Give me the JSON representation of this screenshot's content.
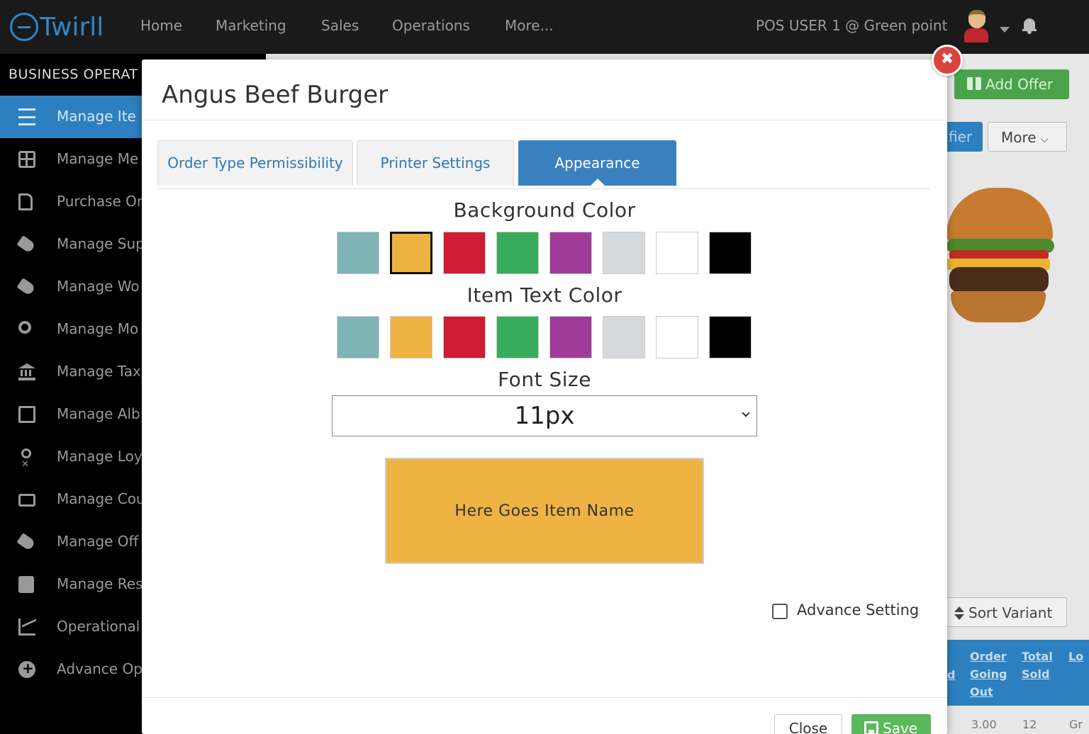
{
  "app": {
    "logo_text": "Twirll"
  },
  "nav": {
    "items": [
      "Home",
      "Marketing",
      "Sales",
      "Operations",
      "More..."
    ],
    "user": "POS USER 1 @ Green point"
  },
  "sidebar": {
    "heading": "BUSINESS OPERAT",
    "items": [
      {
        "label": "Manage Ite",
        "icon": "list-icon",
        "active": true
      },
      {
        "label": "Manage Me",
        "icon": "grid-icon"
      },
      {
        "label": "Purchase Or",
        "icon": "document-icon"
      },
      {
        "label": "Manage Sup",
        "icon": "tags-icon"
      },
      {
        "label": "Manage Wo",
        "icon": "tags-icon"
      },
      {
        "label": "Manage Mo",
        "icon": "gears-icon"
      },
      {
        "label": "Manage Tax",
        "icon": "bank-icon"
      },
      {
        "label": "Manage Alb",
        "icon": "image-icon"
      },
      {
        "label": "Manage Loy",
        "icon": "odnoklassniki-icon"
      },
      {
        "label": "Manage Cou",
        "icon": "ticket-icon"
      },
      {
        "label": "Manage Off",
        "icon": "tags-icon"
      },
      {
        "label": "Manage Res",
        "icon": "contact-card-icon"
      },
      {
        "label": "Operational",
        "icon": "line-chart-icon"
      },
      {
        "label": "Advance Op",
        "icon": "plus-circle-icon"
      }
    ]
  },
  "background": {
    "add_offer": "Add Offer",
    "filter_fragment": "fier",
    "more": "More",
    "sort_variant": "Sort Variant",
    "table_headers": [
      "d",
      "Order Going Out",
      "Total Sold",
      "Lo"
    ],
    "row_values": [
      "3.00",
      "12",
      "Gr"
    ]
  },
  "modal": {
    "title": "Angus Beef Burger",
    "tabs": [
      {
        "label": "Order Type Permissibility",
        "active": false
      },
      {
        "label": "Printer Settings",
        "active": false
      },
      {
        "label": "Appearance",
        "active": true
      }
    ],
    "background_color_label": "Background Color",
    "item_text_color_label": "Item Text Color",
    "font_size_label": "Font Size",
    "font_size_value": "11px",
    "preview_text": "Here Goes Item Name",
    "advance_setting_label": "Advance Setting",
    "close_label": "Close",
    "save_label": "Save"
  },
  "colors": {
    "palette": [
      "#7fb3b6",
      "#efb343",
      "#cf1b34",
      "#37ad5c",
      "#a03b9a",
      "#d6d9dc",
      "#ffffff",
      "#000000"
    ],
    "selected_background_index": 1,
    "preview_background": "#efb343",
    "accent": "#3a81c0"
  }
}
